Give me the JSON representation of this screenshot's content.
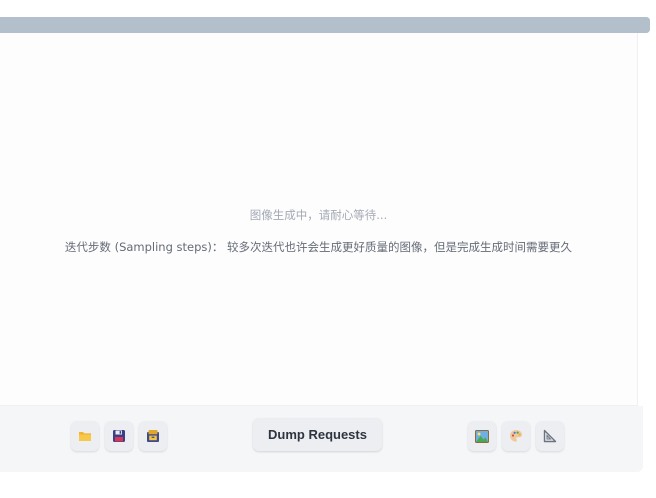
{
  "progress": {
    "fraction": 1.0,
    "color": "#b3bfcb"
  },
  "output": {
    "status_text": "图像生成中，请耐心等待...",
    "hint_text": "迭代步数 (Sampling steps)： 较多次迭代也许会生成更好质量的图像，但是完成生成时间需要更久"
  },
  "toolbar": {
    "left_buttons": [
      {
        "icon": "folder-icon"
      },
      {
        "icon": "floppy-disk-icon"
      },
      {
        "icon": "archive-box-icon"
      }
    ],
    "dump_label": "Dump Requests",
    "right_buttons": [
      {
        "icon": "image-icon"
      },
      {
        "icon": "palette-icon"
      },
      {
        "icon": "triangle-ruler-icon"
      }
    ]
  }
}
